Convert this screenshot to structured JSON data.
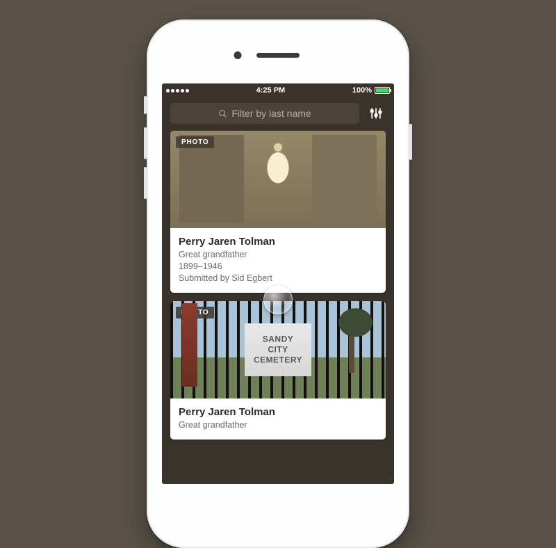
{
  "status": {
    "time": "4:25 PM",
    "battery": "100%"
  },
  "toolbar": {
    "search_placeholder": "Filter by last name"
  },
  "badge_label": "PHOTO",
  "cards": [
    {
      "name": "Perry Jaren Tolman",
      "relation": "Great grandfather",
      "dates": "1899–1946",
      "submitted": "Submitted by Sid Egbert"
    },
    {
      "name": "Perry Jaren Tolman",
      "relation": "Great grandfather",
      "sign_line1": "SANDY",
      "sign_line2": "CITY",
      "sign_line3": "CEMETERY"
    }
  ]
}
